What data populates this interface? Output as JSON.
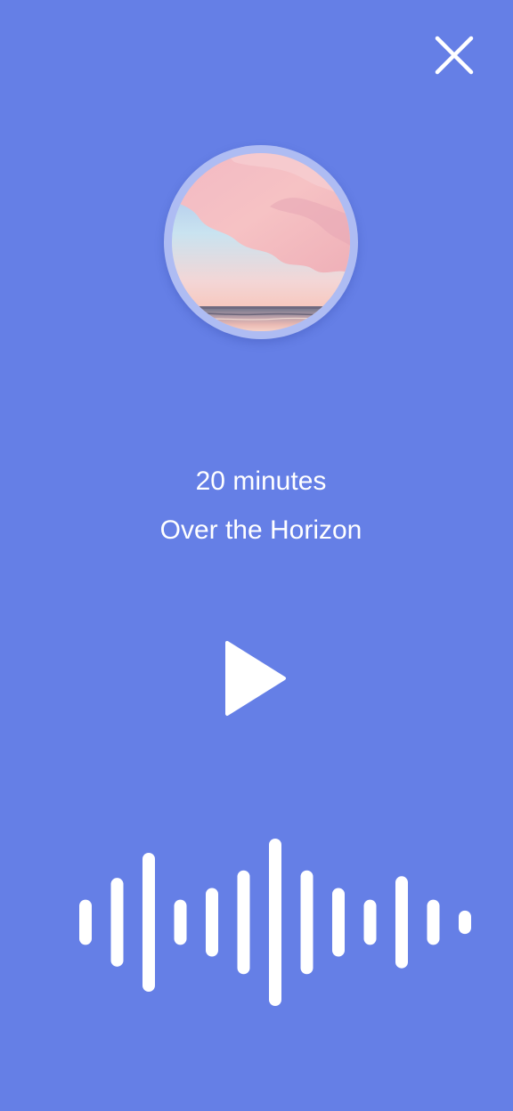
{
  "player": {
    "duration_text": "20 minutes",
    "track_title": "Over the Horizon",
    "state": "paused",
    "icons": {
      "close": "close-icon",
      "play": "play-icon",
      "waveform": "waveform-icon"
    },
    "artwork": {
      "description": "pink sunset clouds over the ocean horizon"
    }
  },
  "colors": {
    "background": "#657FE6",
    "foreground": "#FFFFFF",
    "artwork_ring": "#AEBCF3"
  },
  "waveform": {
    "levels": [
      0.27,
      0.53,
      0.83,
      0.27,
      0.41,
      0.62,
      1.0,
      0.62,
      0.41,
      0.27,
      0.55,
      0.27,
      0.14
    ]
  }
}
